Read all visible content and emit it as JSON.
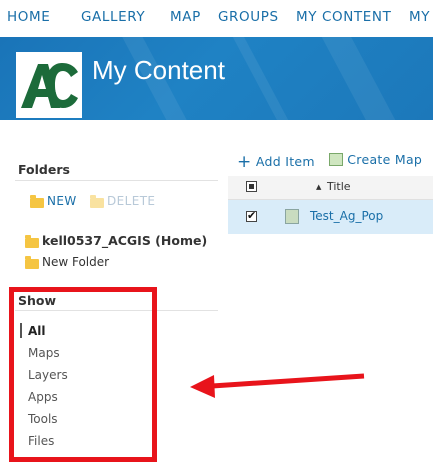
{
  "nav": {
    "items": [
      "HOME",
      "GALLERY",
      "MAP",
      "GROUPS",
      "MY CONTENT",
      "MY"
    ]
  },
  "banner": {
    "logo_text": "AC",
    "title": "My Content"
  },
  "folders": {
    "heading": "Folders",
    "new_label": "NEW",
    "delete_label": "DELETE",
    "items": [
      {
        "label": "kell0537_ACGIS (Home)",
        "bold": true
      },
      {
        "label": "New Folder",
        "bold": false
      }
    ]
  },
  "show": {
    "heading": "Show",
    "items": [
      "All",
      "Maps",
      "Layers",
      "Apps",
      "Tools",
      "Files"
    ],
    "active": "All"
  },
  "toolbar": {
    "add_item": "Add Item",
    "create_map": "Create Map"
  },
  "table": {
    "title_header": "Title",
    "rows": [
      {
        "name": "Test_Ag_Pop",
        "checked": true
      }
    ]
  },
  "colors": {
    "accent": "#1a6fa8",
    "banner": "#1f82c4",
    "annotation": "#e8141b",
    "logo_green": "#1c6b3a"
  }
}
